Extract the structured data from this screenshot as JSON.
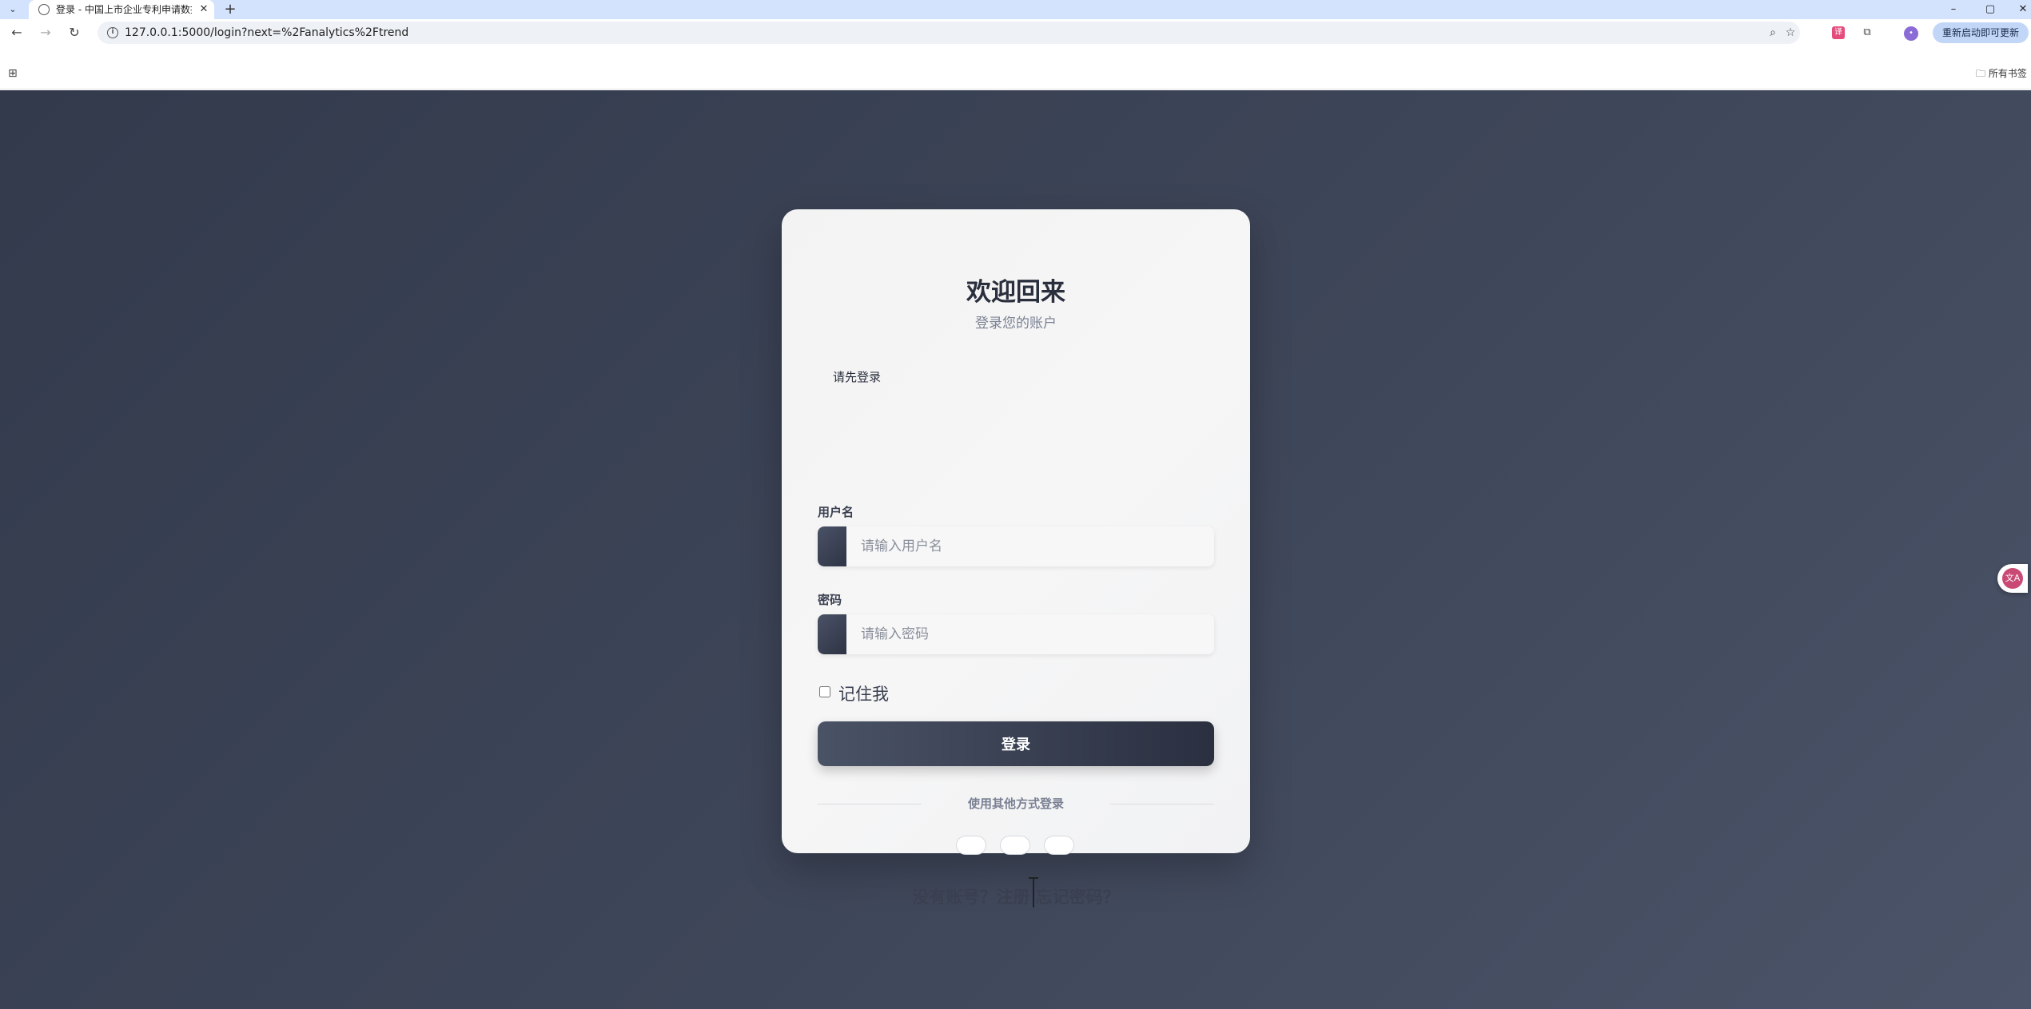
{
  "browser": {
    "tab_title": "登录 - 中国上市企业专利申请数据",
    "tab_menu_icon": "⌄",
    "tab_close": "✕",
    "new_tab": "+",
    "url": "127.0.0.1:5000/login?next=%2Fanalytics%2Ftrend",
    "update_button": "重新启动即可更新",
    "bookmarks_folder": "所有书签",
    "window_controls": {
      "minimize": "–",
      "maximize": "▢",
      "close": "✕"
    }
  },
  "login": {
    "title": "欢迎回来",
    "subtitle": "登录您的账户",
    "flash_message": "请先登录",
    "username_label": "用户名",
    "username_placeholder": "请输入用户名",
    "password_label": "密码",
    "password_placeholder": "请输入密码",
    "remember_label": "记住我",
    "submit_label": "登录",
    "divider_text": "使用其他方式登录",
    "no_account_text": "没有账号？",
    "register_link": "注册",
    "forgot_link": "忘记密码？"
  },
  "colors": {
    "background": "#3a4255",
    "card": "#f4f4f4",
    "button": "#3b4256",
    "browser_tabstrip": "#d3e3fd"
  }
}
